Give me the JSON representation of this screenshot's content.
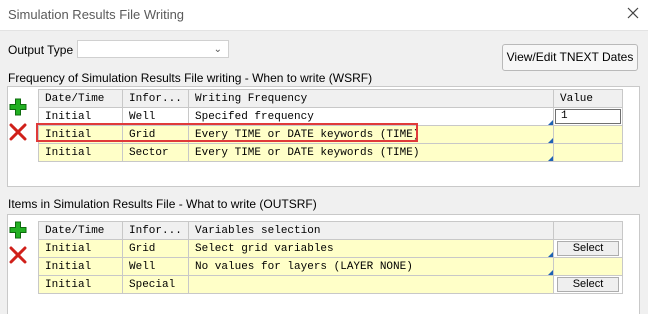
{
  "window": {
    "title": "Simulation Results File Writing"
  },
  "output_type": {
    "label": "Output Type",
    "value": ""
  },
  "toolbar": {
    "dates_button": "View/Edit TNEXT Dates"
  },
  "wsrf": {
    "label": "Frequency of Simulation Results File writing -  When to write (WSRF)",
    "headers": [
      "Date/Time",
      "Infor...",
      "Writing Frequency",
      "Value"
    ],
    "rows": [
      {
        "date": "Initial",
        "info": "Well",
        "freq": "Specifed frequency",
        "value": "1"
      },
      {
        "date": "Initial",
        "info": "Grid",
        "freq": "Every TIME or DATE keywords (TIME)",
        "value": ""
      },
      {
        "date": "Initial",
        "info": "Sector",
        "freq": "Every TIME or DATE keywords (TIME)",
        "value": ""
      }
    ]
  },
  "outsrf": {
    "label": "Items in Simulation Results File - What to write (OUTSRF)",
    "headers": [
      "Date/Time",
      "Infor...",
      "Variables selection",
      ""
    ],
    "rows": [
      {
        "date": "Initial",
        "info": "Grid",
        "vars": "Select grid variables",
        "action": "Select"
      },
      {
        "date": "Initial",
        "info": "Well",
        "vars": "No values for layers (LAYER NONE)",
        "action": ""
      },
      {
        "date": "Initial",
        "info": "Special",
        "vars": "",
        "action": "Select"
      }
    ]
  },
  "icons": {
    "add": "plus-icon",
    "delete": "delete-x-icon",
    "close": "close-icon"
  },
  "colors": {
    "editable_cell": "#ffffc8",
    "highlight": "#e03a3a",
    "add_green": "#1aa31a",
    "delete_red": "#d0201a"
  }
}
